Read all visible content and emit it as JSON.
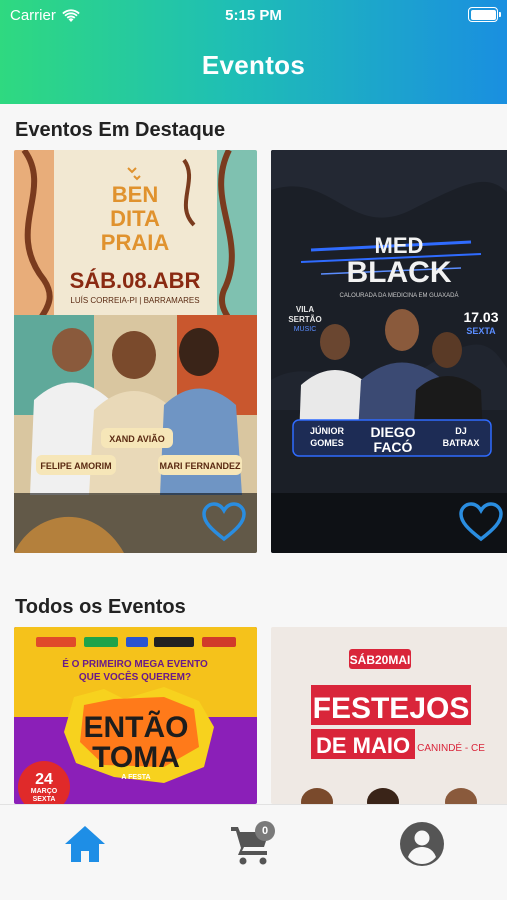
{
  "status_bar": {
    "carrier": "Carrier",
    "time": "5:15 PM"
  },
  "header": {
    "title": "Eventos"
  },
  "featured": {
    "section_title": "Eventos Em Destaque",
    "events": [
      {
        "title_lines": [
          "BEN",
          "DITA",
          "PRAIA"
        ],
        "date": "SÁB.08.ABR",
        "location": "LUÍS CORREIA-PI | BARRAMARES",
        "artists": [
          "XAND AVIÃO",
          "FELIPE AMORIM",
          "MARI FERNANDEZ"
        ]
      },
      {
        "title_lines": [
          "MED",
          "BLACK"
        ],
        "subtitle": "CALOURADA DA MEDICINA EM GUAXADÁ",
        "date": "17.03",
        "weekday": "SEXTA",
        "venue_lines": [
          "VILA",
          "SERTÃO",
          "MUSIC"
        ],
        "artists": [
          "JÚNIOR",
          "GOMES",
          "DIEGO",
          "FACÓ",
          "DJ",
          "BATRAX"
        ]
      }
    ]
  },
  "all_events": {
    "section_title": "Todos os Eventos",
    "events": [
      {
        "top_line": "É O PRIMEIRO MEGA EVENTO",
        "question": "QUE VOCÊS QUEREM?",
        "title_lines": [
          "ENTÃO",
          "TOMA"
        ],
        "tagline": "A FESTA",
        "date_day": "24",
        "date_month": "MARÇO",
        "date_weekday": "SEXTA"
      },
      {
        "date": "SÁB20MAI",
        "title_lines": [
          "FESTEJOS",
          "DE MAIO"
        ],
        "location": "CANINDÉ - CE"
      }
    ]
  },
  "tabbar": {
    "cart_count": "0",
    "items": [
      {
        "icon": "home-icon",
        "active": true
      },
      {
        "icon": "cart-icon",
        "active": false
      },
      {
        "icon": "account-icon",
        "active": false
      }
    ]
  },
  "colors": {
    "accent": "#1e8ee6",
    "inactive_icon": "#555555",
    "heart": "#2a8de0"
  }
}
